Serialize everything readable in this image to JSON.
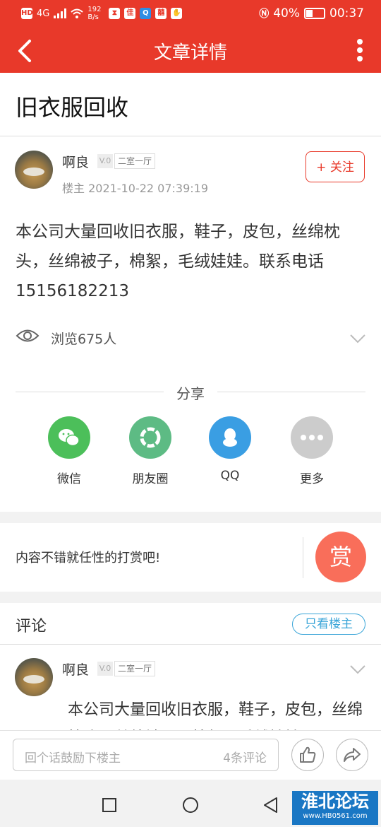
{
  "status_bar": {
    "left_indicators": [
      "HD",
      "4G",
      "192 B/s"
    ],
    "battery": "40%",
    "time": "00:37"
  },
  "navbar": {
    "title": "文章详情",
    "back_icon": "chevron-left-icon",
    "more_icon": "more-vertical-icon"
  },
  "article": {
    "title": "旧衣服回收"
  },
  "post": {
    "author": "啊良",
    "level": "V.0",
    "rank": "二室一厅",
    "role": "楼主",
    "datetime": "2021-10-22 07:39:19",
    "meta": "楼主  2021-10-22 07:39:19",
    "follow_label": "+ 关注",
    "body": "本公司大量回收旧衣服，鞋子，皮包，丝绵枕头，丝绵被子，棉絮，毛绒娃娃。联系电话15156182213",
    "views": "浏览675人"
  },
  "share": {
    "title": "分享",
    "items": [
      {
        "label": "微信",
        "icon": "wechat-icon",
        "color": "#4cbf5a"
      },
      {
        "label": "朋友圈",
        "icon": "moments-icon",
        "color": "#5dbb84"
      },
      {
        "label": "QQ",
        "icon": "qq-icon",
        "color": "#3a9ee3"
      },
      {
        "label": "更多",
        "icon": "more-dots-icon",
        "color": "#cccccc"
      }
    ]
  },
  "reward": {
    "text": "内容不错就任性的打赏吧!",
    "button": "赏"
  },
  "comments": {
    "title": "评论",
    "only_op": "只看楼主",
    "first": {
      "author": "啊良",
      "level": "V.0",
      "rank": "二室一厅",
      "body": "本公司大量回收旧衣服，鞋子，皮包，丝绵枕头，丝绵被子，棉絮，毛绒娃娃。"
    }
  },
  "bottom_bar": {
    "placeholder": "回个话鼓励下楼主",
    "count": "4条评论"
  },
  "watermark": {
    "big": "淮北论坛",
    "small": "www.HB0561.com"
  },
  "colors": {
    "brand_red": "#e8392a",
    "accent_blue": "#3aa5d8",
    "reward_orange": "#f96e5a"
  }
}
